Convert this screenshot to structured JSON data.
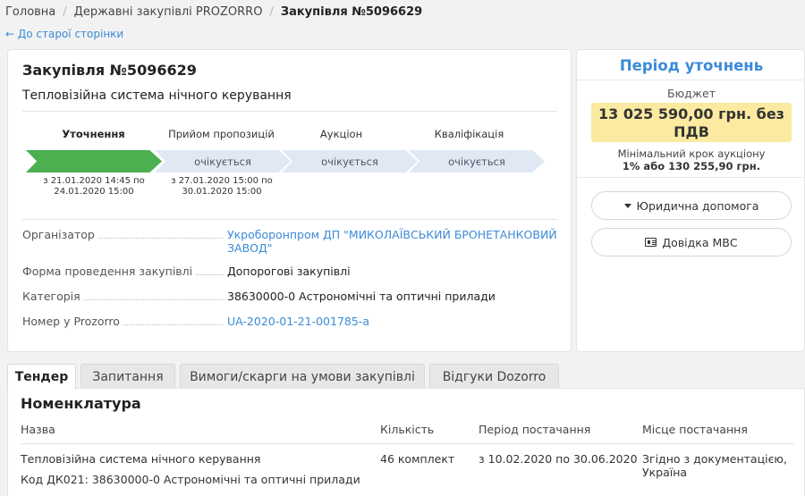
{
  "breadcrumb": {
    "home": "Головна",
    "section": "Державні закупівлі PROZORRO",
    "current": "Закупівля №5096629",
    "back": "← До старої сторінки"
  },
  "tender": {
    "title": "Закупівля №5096629",
    "subject": "Тепловізійна система нічного керування",
    "stages": [
      {
        "label": "Уточнення",
        "status": "",
        "dates": "з 21.01.2020 14:45 по 24.01.2020 15:00"
      },
      {
        "label": "Прийом пропозицій",
        "status": "очікується",
        "dates": "з 27.01.2020 15:00 по 30.01.2020 15:00"
      },
      {
        "label": "Аукціон",
        "status": "очікується",
        "dates": ""
      },
      {
        "label": "Кваліфікація",
        "status": "очікується",
        "dates": ""
      }
    ],
    "info": {
      "organizer_label": "Організатор",
      "organizer_value": "Укроборонпром ДП \"МИКОЛАЇВСЬКИЙ БРОНЕТАНКОВИЙ ЗАВОД\"",
      "form_label": "Форма проведення закупівлі",
      "form_value": "Допорогові закупівлі",
      "category_label": "Категорія",
      "category_value": "38630000-0 Астрономічні та оптичні прилади",
      "prozorro_label": "Номер у Prozorro",
      "prozorro_value": "UA-2020-01-21-001785-a"
    }
  },
  "sidebar": {
    "period": "Період уточнень",
    "budget_label": "Бюджет",
    "budget_value": "13 025 590,00 грн. без ПДВ",
    "min_step_label": "Мінімальний крок аукціону",
    "min_step_value": "1% або 130 255,90 грн.",
    "legal_help": "Юридична допомога",
    "mvs_reference": "Довідка МВС"
  },
  "tabs": [
    "Тендер",
    "Запитання",
    "Вимоги/скарги на умови закупівлі",
    "Відгуки Dozorro"
  ],
  "nomenclature": {
    "title": "Номенклатура",
    "headers": [
      "Назва",
      "Кількість",
      "Період постачання",
      "Місце постачання"
    ],
    "row": {
      "name": "Тепловізійна система нічного керування",
      "code": "Код ДК021: 38630000-0 Астрономічні та оптичні прилади",
      "quantity": "46 комплект",
      "period": "з 10.02.2020 по 30.06.2020",
      "place": "Згідно з документацією, Україна"
    }
  },
  "colors": {
    "accent": "#3c8ad8",
    "active_stage": "#4caf50",
    "pending_stage": "#dfe8f3",
    "budget_bg": "#fbeaa0"
  }
}
